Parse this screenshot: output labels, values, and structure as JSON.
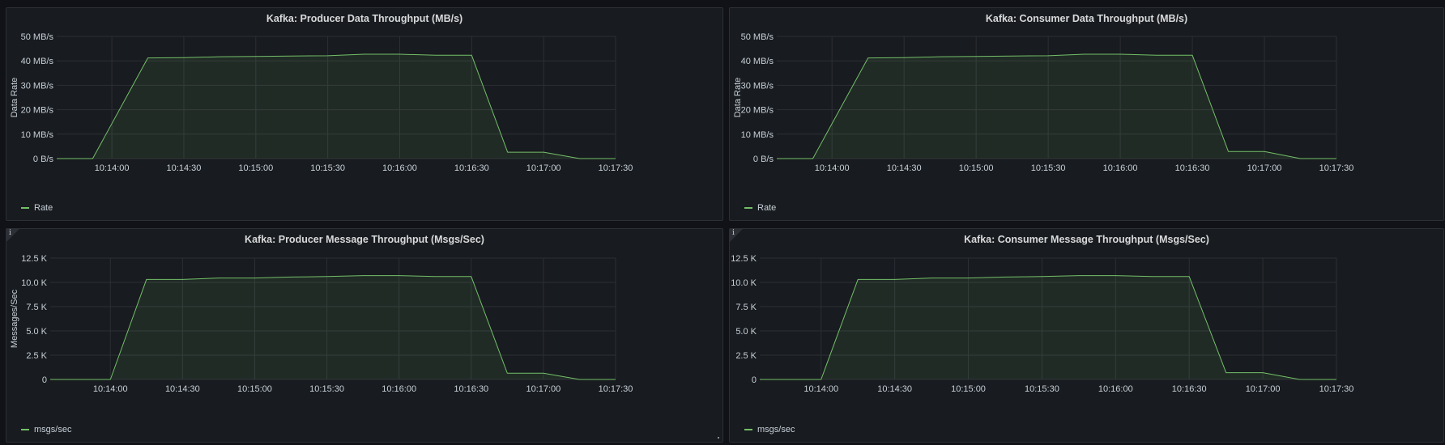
{
  "colors": {
    "series": "#73bf69",
    "grid": "#2c2f35",
    "background": "#111217",
    "panel": "#181b1f"
  },
  "panels": [
    {
      "title": "Kafka: Producer Data Throughput (MB/s)",
      "legend": "Rate"
    },
    {
      "title": "Kafka: Consumer Data Throughput (MB/s)",
      "legend": "Rate"
    },
    {
      "title": "Kafka: Producer Message Throughput (Msgs/Sec)",
      "legend": "msgs/sec",
      "info_icon": "info-icon"
    },
    {
      "title": "Kafka: Consumer Message Throughput (Msgs/Sec)",
      "legend": "msgs/sec",
      "info_icon": "info-icon"
    }
  ],
  "chart_data": [
    {
      "type": "area",
      "title": "Kafka: Producer Data Throughput (MB/s)",
      "ylabel": "Data Rate",
      "xlabel": "",
      "ylim": [
        0,
        50
      ],
      "yticks": [
        0,
        10,
        20,
        30,
        40,
        50
      ],
      "ytick_labels": [
        "0 B/s",
        "10 MB/s",
        "20 MB/s",
        "30 MB/s",
        "40 MB/s",
        "50 MB/s"
      ],
      "xlim": [
        "10:13:37",
        "10:17:30"
      ],
      "xticks": [
        "10:14:00",
        "10:14:30",
        "10:15:00",
        "10:15:30",
        "10:16:00",
        "10:16:30",
        "10:17:00",
        "10:17:30"
      ],
      "grid": true,
      "legend_position": "bottom-left",
      "series": [
        {
          "name": "Rate",
          "x": [
            "10:13:37",
            "10:13:52",
            "10:14:15",
            "10:14:30",
            "10:14:45",
            "10:15:00",
            "10:15:15",
            "10:15:30",
            "10:15:45",
            "10:16:00",
            "10:16:15",
            "10:16:30",
            "10:16:45",
            "10:17:00",
            "10:17:15",
            "10:17:30"
          ],
          "values": [
            0,
            0,
            41.2,
            41.3,
            41.7,
            41.8,
            42.0,
            42.1,
            42.7,
            42.7,
            42.3,
            42.3,
            2.6,
            2.6,
            0,
            0
          ]
        }
      ]
    },
    {
      "type": "area",
      "title": "Kafka: Consumer Data Throughput (MB/s)",
      "ylabel": "Data Rate",
      "xlabel": "",
      "ylim": [
        0,
        50
      ],
      "yticks": [
        0,
        10,
        20,
        30,
        40,
        50
      ],
      "ytick_labels": [
        "0 B/s",
        "10 MB/s",
        "20 MB/s",
        "30 MB/s",
        "40 MB/s",
        "50 MB/s"
      ],
      "xlim": [
        "10:13:37",
        "10:17:30"
      ],
      "xticks": [
        "10:14:00",
        "10:14:30",
        "10:15:00",
        "10:15:30",
        "10:16:00",
        "10:16:30",
        "10:17:00",
        "10:17:30"
      ],
      "grid": true,
      "legend_position": "bottom-left",
      "series": [
        {
          "name": "Rate",
          "x": [
            "10:13:37",
            "10:13:52",
            "10:14:15",
            "10:14:30",
            "10:14:45",
            "10:15:00",
            "10:15:15",
            "10:15:30",
            "10:15:45",
            "10:16:00",
            "10:16:15",
            "10:16:30",
            "10:16:45",
            "10:17:00",
            "10:17:15",
            "10:17:30"
          ],
          "values": [
            0,
            0,
            41.2,
            41.3,
            41.7,
            41.8,
            42.0,
            42.1,
            42.7,
            42.7,
            42.3,
            42.3,
            2.9,
            2.9,
            0,
            0
          ]
        }
      ]
    },
    {
      "type": "area",
      "title": "Kafka: Producer Message Throughput (Msgs/Sec)",
      "ylabel": "Messages/Sec",
      "xlabel": "",
      "ylim": [
        0,
        12500
      ],
      "yticks": [
        0,
        2500,
        5000,
        7500,
        10000,
        12500
      ],
      "ytick_labels": [
        "0",
        "2.5 K",
        "5.0 K",
        "7.5 K",
        "10.0 K",
        "12.5 K"
      ],
      "xlim": [
        "10:13:35",
        "10:17:30"
      ],
      "xticks": [
        "10:14:00",
        "10:14:30",
        "10:15:00",
        "10:15:30",
        "10:16:00",
        "10:16:30",
        "10:17:00",
        "10:17:30"
      ],
      "grid": true,
      "legend_position": "bottom-left",
      "series": [
        {
          "name": "msgs/sec",
          "x": [
            "10:13:35",
            "10:14:00",
            "10:14:15",
            "10:14:30",
            "10:14:45",
            "10:15:00",
            "10:15:15",
            "10:15:30",
            "10:15:45",
            "10:16:00",
            "10:16:15",
            "10:16:30",
            "10:16:45",
            "10:17:00",
            "10:17:15",
            "10:17:30"
          ],
          "values": [
            0,
            0,
            10300,
            10300,
            10450,
            10450,
            10550,
            10600,
            10700,
            10700,
            10600,
            10600,
            650,
            650,
            0,
            0
          ]
        }
      ]
    },
    {
      "type": "area",
      "title": "Kafka: Consumer Message Throughput (Msgs/Sec)",
      "ylabel": "",
      "xlabel": "",
      "ylim": [
        0,
        12500
      ],
      "yticks": [
        0,
        2500,
        5000,
        7500,
        10000,
        12500
      ],
      "ytick_labels": [
        "0",
        "2.5 K",
        "5.0 K",
        "7.5 K",
        "10.0 K",
        "12.5 K"
      ],
      "xlim": [
        "10:13:35",
        "10:17:30"
      ],
      "xticks": [
        "10:14:00",
        "10:14:30",
        "10:15:00",
        "10:15:30",
        "10:16:00",
        "10:16:30",
        "10:17:00",
        "10:17:30"
      ],
      "grid": true,
      "legend_position": "bottom-left",
      "series": [
        {
          "name": "msgs/sec",
          "x": [
            "10:13:35",
            "10:14:00",
            "10:14:15",
            "10:14:30",
            "10:14:45",
            "10:15:00",
            "10:15:15",
            "10:15:30",
            "10:15:45",
            "10:16:00",
            "10:16:15",
            "10:16:30",
            "10:16:45",
            "10:17:00",
            "10:17:15",
            "10:17:30"
          ],
          "values": [
            0,
            0,
            10300,
            10300,
            10450,
            10450,
            10550,
            10600,
            10700,
            10700,
            10600,
            10600,
            700,
            700,
            0,
            0
          ]
        }
      ]
    }
  ]
}
